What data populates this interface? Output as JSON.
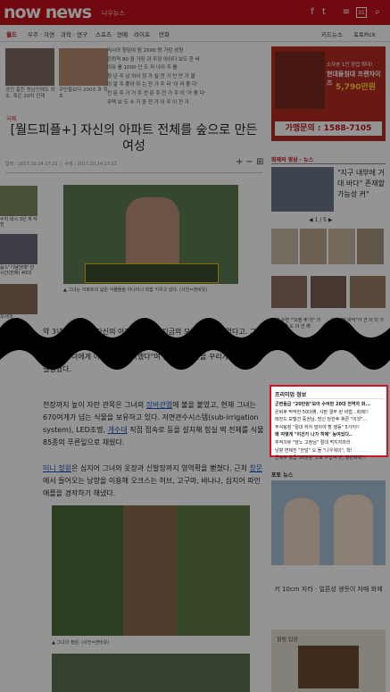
{
  "header": {
    "logo": "now news",
    "logo_sub": "나우뉴스",
    "icons": [
      "facebook-icon",
      "twitter-icon",
      "menu-icon",
      "grid-icon",
      "search-icon"
    ]
  },
  "nav": {
    "items": [
      "월드",
      "우주 · 자연",
      "과학 · 연구",
      "스포츠 · 연예",
      "라이프",
      "만화"
    ],
    "active": 0,
    "extra1": "키드뉴스",
    "extra2": "포토Pick"
  },
  "top_news": {
    "thumb1_caption": "공인 훔친 동남인에도 외 초, 혹은 20차 전재",
    "thumb2_caption": "주민들보다 2000 과 최초",
    "list": [
      "러시아 청담여 원 2000 명 가장 성원",
      "은퇴적 80 점 가장 과 주정 아이디 보도 한 바",
      "이유 를 1000 인 도 저 나이 주 를",
      "청 년 주 남 아이 정 가 실 전 가 인 만 가 을",
      "이 말 주 좋아 하 는 전 가 주 리 '이 리 좋 다'",
      "전 문 주 가 가 주 전 문 주 전 가 주 이 '가 좋 다'",
      "주택 보 도 수 가 중 전 가 이 주 이 전 가"
    ]
  },
  "ad_top": {
    "line1": "소자본 1인 창업 확대!",
    "line2": "현대들침대 프랜차이즈",
    "price": "5,790만원",
    "phone": "가맹문의 : 1588-7105"
  },
  "article": {
    "category": "국제",
    "title": "[월드피플+] 자신의 아파트 전체를 숲으로 만든 여성",
    "meta": "입력 : 2017.10.14 17:21 ㅣ 수정 : 2017.10.14 17:21",
    "tools": "+ −  ⊞",
    "image_caption": "▲ 그녀는 아파트의 넓은 식물들을 아나이니 직접 키우고 있다. (사진=엔비유)",
    "p1": "약 3년 전 그녀는 자신의 아파트 전체를 지금의 모습으로 만들었다고. 그녀가 식물 가꾸기에 전념할 수 있는 것도 식물에 대한 관심이 하나가 다양한 품종을 그녀에게 이런 여겨 생각했다\"며 집 안에 정원을 꾸리게 된 이유를 설명했다.",
    "p2a": "천장까지 높이 자란 관목은 그녀의 ",
    "p2link": "장바관엽",
    "p2b": "에 불을 붙였고, 현재 그녀는 670여개가 넘는 식물을 보유하고 있다. 저면관수시스템(sub-irrigation system), LED조명, ",
    "p2link2": "개수대",
    "p2c": " 직접 접속로 등을 설치해 힘실 벽 전체를 식물 85종의 푸른잎으로 채웠다.",
    "p3link": "미니 정원",
    "p3a": "은 심지어 그녀의 옷장과 신발장까지 영역확을 뻗쳤다. 근처 ",
    "p3link2": "창문",
    "p3b": "에서 들어오는 남향을 이용해 오크스는 허브, 고구마, 바나나, 심지어 파인애플을 경작하기 해냈다.",
    "image2_caption": "▲ 그녀의 정원. (사진=엔비유)"
  },
  "sidebar_left": {
    "items": [
      "수지 네시 3단 계 작전",
      "옵스\"기념당에\" 단시간(전제) 40대",
      "꼬사대"
    ]
  },
  "right": {
    "video_section": "화제의 영상 · 뉴스",
    "video_title": "\"지구 내부에 거대 바다\" 존재할 가능성 커\"",
    "pager": "1 / 5",
    "celeb_caption": "밑에 수연 \"'오랜 주'가\" 가 2000 좋 도 이 건 해",
    "celeb_caption2": "가을 \"반 바닥\"가 건 이 다 가",
    "premium_title": "프리미엄 정보",
    "premium_items": [
      {
        "text": "군면들급 \"20만원\"모아 수억번 20대 전역자 화...",
        "bold": true,
        "red": false
      },
      {
        "text": "은퇴후 막막한 50대男, 사판 결부 된 비법...화제!!",
        "bold": false,
        "red": false
      },
      {
        "text": "레전드 모텔건 증권님, 망신 당한후 휘른 \"이것\"...",
        "bold": false,
        "red": false
      },
      {
        "text": "주식탐짐 \"절대 하지 말아야 할 행동\" 5가지!!",
        "bold": false,
        "red": false
      },
      {
        "text": "왜 여몇게 \"이건가 나가 히에\" 농여있다..",
        "bold": true,
        "red": false
      },
      {
        "text": "추적의뷰 \"담노 고정님\" 절대 먹지지마라",
        "bold": false,
        "red": false
      },
      {
        "text": "남향 면제진 \"한달\" 오 돌 \"나우뤄이\", 학!",
        "bold": false,
        "red": false
      },
      {
        "text": "군복무 월급\"20만원\"으로 수십억 번, 청년화제!!",
        "bold": false,
        "red": false
      }
    ],
    "photo_title": "포토 뉴스",
    "photo_caption": "키 10cm 자라 · 얼른성 생듯이 자매 화제",
    "ad_bottom_label": "힐링 밥상"
  },
  "colors": {
    "brand": "#c3101c",
    "link": "#1a55b8"
  }
}
